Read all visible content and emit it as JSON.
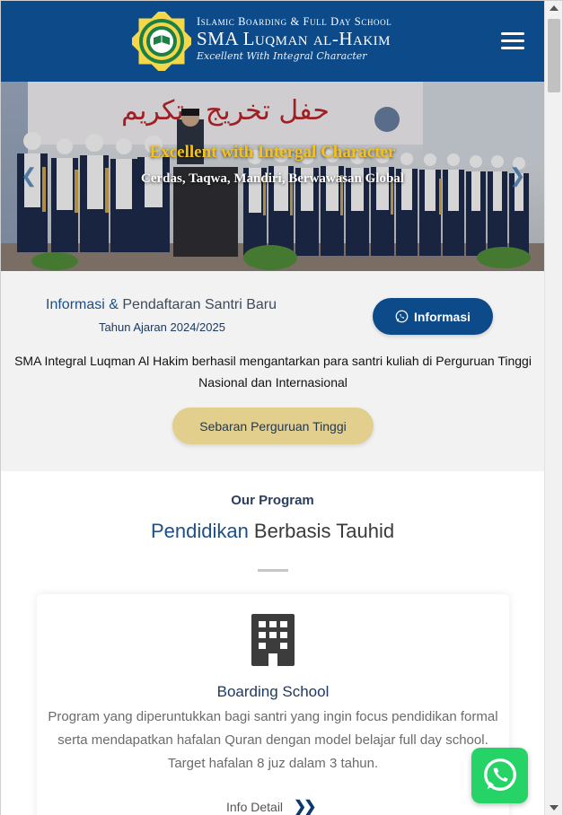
{
  "header": {
    "school_small": "Islamic Boarding & Full Day School",
    "school_name": "SMA Luqman al-Hakim",
    "tagline": "Excellent With Integral Character",
    "badge_text": "SMA INTEGRAL LUQMAN AL HAKIM SURABAYA",
    "menu_icon": "hamburger-icon"
  },
  "hero": {
    "banner_text": "حفل تخريج وتكريم",
    "title": "Excellent with Intergal Character",
    "subtitle": "Cerdas, Taqwa, Mandiri, Berwawasan Global",
    "prev_icon": "chevron-left-icon",
    "next_icon": "chevron-right-icon"
  },
  "info": {
    "title_highlight": "Informasi &",
    "title_rest": " Pendaftaran Santri Baru",
    "year": "Tahun Ajaran 2024/2025",
    "button_label": "Informasi",
    "button_icon": "whatsapp-icon",
    "description": "SMA Integral Luqman Al Hakim berhasil mengantarkan para santri kuliah di Perguruan Tinggi Nasional dan Internasional",
    "sebaran_label": "Sebaran Perguruan Tinggi"
  },
  "program": {
    "label": "Our Program",
    "title_highlight": "Pendidikan",
    "title_rest": " Berbasis Tauhid",
    "card": {
      "icon": "building-icon",
      "title": "Boarding School",
      "description": "Program yang diperuntukkan bagi santri yang ingin focus pendidikan formal serta mendapatkan hafalan Quran dengan model belajar full day school. Target hafalan 8 juz dalam 3 tahun.",
      "link_label": "Info Detail",
      "link_icon": "double-chevron-right-icon"
    }
  },
  "floating": {
    "whatsapp_icon": "whatsapp-icon"
  },
  "colors": {
    "primary": "#0c4a8a",
    "hero_title": "#f4c21a",
    "sebaran_button": "#e2cf8e",
    "whatsapp": "#25d366"
  }
}
